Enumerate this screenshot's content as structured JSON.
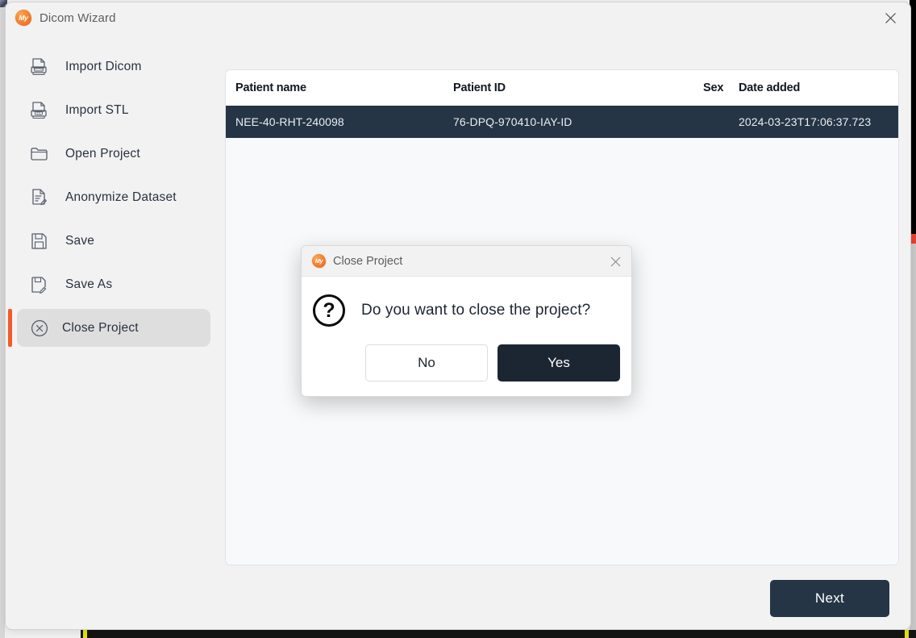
{
  "window": {
    "title": "Dicom Wizard",
    "logo_text": "My",
    "close_icon": "close-icon"
  },
  "sidebar": {
    "items": [
      {
        "label": "Import Dicom",
        "icon": "import-dicom-icon",
        "active": false
      },
      {
        "label": "Import STL",
        "icon": "import-stl-icon",
        "active": false
      },
      {
        "label": "Open Project",
        "icon": "folder-open-icon",
        "active": false
      },
      {
        "label": "Anonymize Dataset",
        "icon": "document-edit-icon",
        "active": false
      },
      {
        "label": "Save",
        "icon": "floppy-disk-icon",
        "active": false
      },
      {
        "label": "Save As",
        "icon": "floppy-disk-edit-icon",
        "active": false
      },
      {
        "label": "Close Project",
        "icon": "close-circle-icon",
        "active": true
      }
    ]
  },
  "table": {
    "columns": [
      "Patient name",
      "Patient ID",
      "Sex",
      "Date added"
    ],
    "rows": [
      {
        "patient_name": "NEE-40-RHT-240098",
        "patient_id": "76-DPQ-970410-IAY-ID",
        "sex": "",
        "date_added": "2024-03-23T17:06:37.723",
        "selected": true
      }
    ]
  },
  "footer": {
    "next_label": "Next"
  },
  "modal": {
    "title": "Close Project",
    "logo_text": "My",
    "question_glyph": "?",
    "message": "Do you want to close the project?",
    "no_label": "No",
    "yes_label": "Yes",
    "close_icon": "close-icon"
  },
  "colors": {
    "accent_orange": "#f15a29",
    "dark_navy": "#253546",
    "modal_button_dark": "#1c2633",
    "window_bg": "#f2f2f2",
    "panel_bg": "#f8f9fa"
  }
}
